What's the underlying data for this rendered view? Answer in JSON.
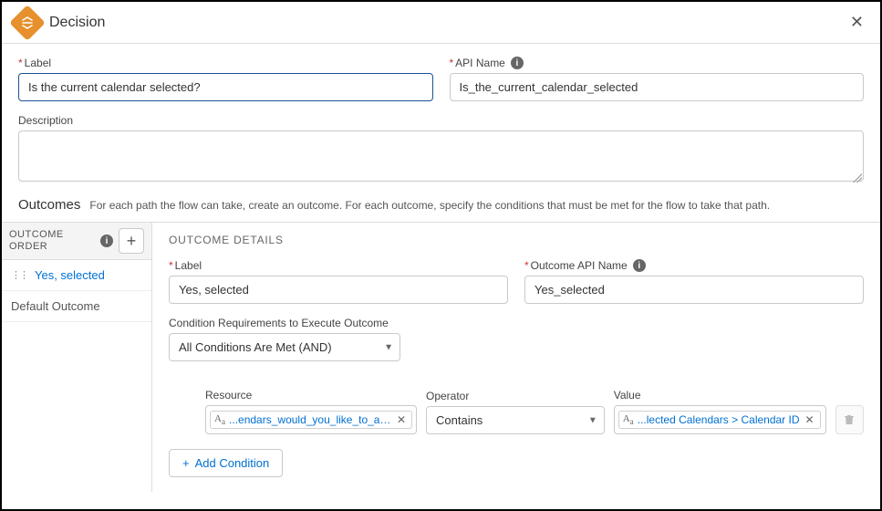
{
  "header": {
    "title": "Decision"
  },
  "topForm": {
    "label_label": "Label",
    "label_value": "Is the current calendar selected?",
    "api_label": "API Name",
    "api_value": "Is_the_current_calendar_selected",
    "desc_label": "Description",
    "desc_value": ""
  },
  "outcomes": {
    "heading": "Outcomes",
    "desc": "For each path the flow can take, create an outcome. For each outcome, specify the conditions that must be met for the flow to take that path."
  },
  "sidebar": {
    "title": "OUTCOME ORDER",
    "items": [
      "Yes, selected",
      "Default Outcome"
    ]
  },
  "details": {
    "heading": "OUTCOME DETAILS",
    "label_label": "Label",
    "label_value": "Yes, selected",
    "api_label": "Outcome API Name",
    "api_value": "Yes_selected",
    "cond_req_label": "Condition Requirements to Execute Outcome",
    "cond_req_value": "All Conditions Are Met (AND)",
    "resource_label": "Resource",
    "resource_pill": "...endars_would_you_like_to_add",
    "operator_label": "Operator",
    "operator_value": "Contains",
    "value_label": "Value",
    "value_pill": "...lected Calendars > Calendar ID",
    "add_cond": "Add Condition"
  }
}
